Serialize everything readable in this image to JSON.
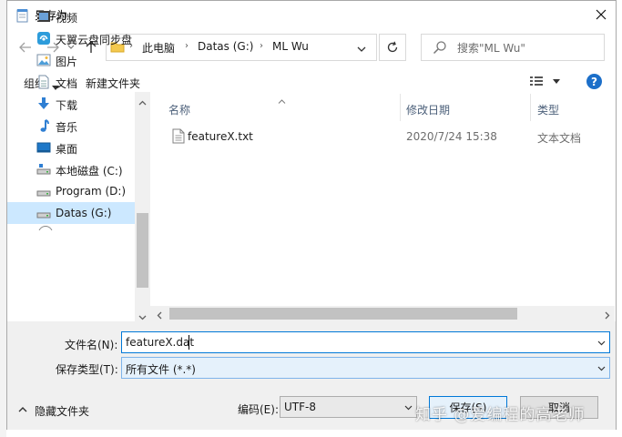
{
  "window": {
    "title": "另存为"
  },
  "address": {
    "crumbs": [
      "此电脑",
      "Datas (G:)",
      "ML Wu"
    ]
  },
  "search": {
    "placeholder": "搜索\"ML Wu\""
  },
  "toolbar": {
    "organize": "组织",
    "new_folder": "新建文件夹"
  },
  "nav": {
    "items": [
      {
        "label": "视频",
        "icon": "video-icon"
      },
      {
        "label": "天翼云盘同步盘",
        "icon": "cloud-sync-icon"
      },
      {
        "label": "图片",
        "icon": "picture-icon"
      },
      {
        "label": "文档",
        "icon": "document-icon"
      },
      {
        "label": "下载",
        "icon": "download-icon"
      },
      {
        "label": "音乐",
        "icon": "music-icon"
      },
      {
        "label": "桌面",
        "icon": "desktop-icon"
      },
      {
        "label": "本地磁盘 (C:)",
        "icon": "drive-icon"
      },
      {
        "label": "Program (D:)",
        "icon": "drive-icon"
      },
      {
        "label": "Datas (G:)",
        "icon": "drive-icon"
      }
    ],
    "selected": "Datas (G:)"
  },
  "file_list": {
    "columns": {
      "name": "名称",
      "date": "修改日期",
      "type": "类型"
    },
    "rows": [
      {
        "name": "featureX.txt",
        "date": "2020/7/24 15:38",
        "type": "文本文档"
      }
    ]
  },
  "form": {
    "filename_label": "文件名(N):",
    "filename_value": "featureX.dat",
    "filetype_label": "保存类型(T):",
    "filetype_value": "所有文件  (*.*)",
    "encoding_label": "编码(E):",
    "encoding_value": "UTF-8"
  },
  "footer": {
    "hide_folders": "隐藏文件夹",
    "save": "保存(S)",
    "cancel": "取消"
  },
  "watermark": "知乎 @爱编程的高老师",
  "colors": {
    "accent": "#0078d7",
    "selection": "#cce8ff",
    "help": "#1c6fc9"
  }
}
